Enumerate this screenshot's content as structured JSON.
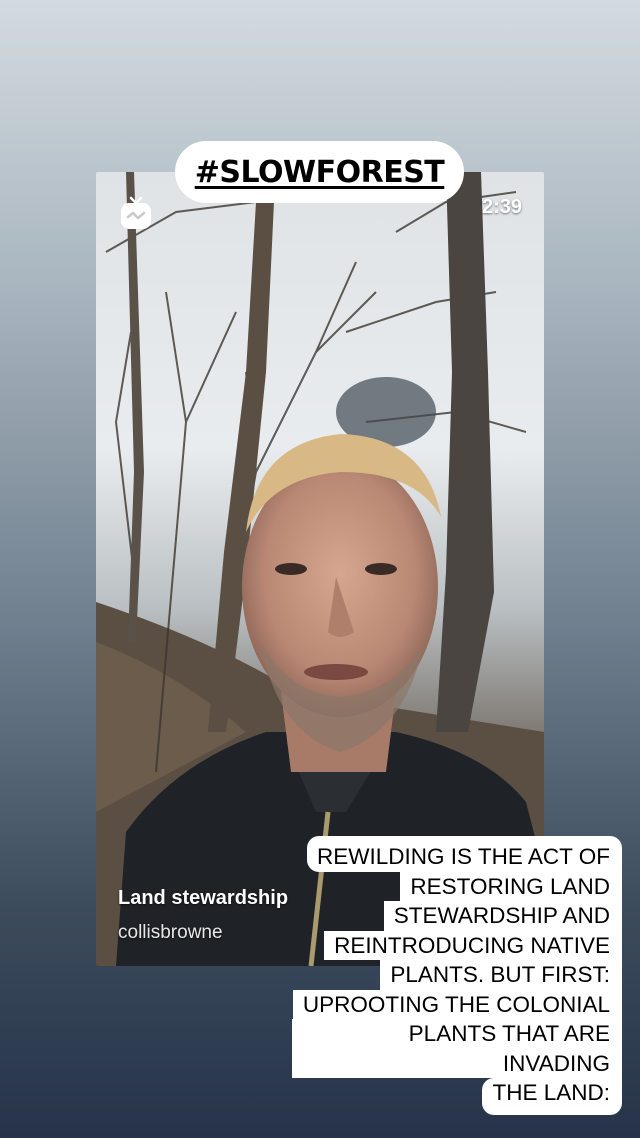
{
  "story": {
    "hashtag": "#SLOWFOREST",
    "caption_lines": [
      "REWILDING IS THE ACT OF",
      "RESTORING LAND",
      "STEWARDSHIP AND",
      "REINTRODUCING NATIVE",
      "PLANTS. BUT FIRST:",
      "UPROOTING THE COLONIAL",
      "PLANTS THAT ARE INVADING",
      "THE LAND:"
    ]
  },
  "video": {
    "duration": "2:39",
    "title": "Land stewardship",
    "username": "collisbrowne",
    "icon": "igtv-icon"
  },
  "colors": {
    "background_top": "#d3dbe0",
    "background_bottom": "#26334a",
    "sticker_bg": "#ffffff",
    "text": "#000000"
  }
}
